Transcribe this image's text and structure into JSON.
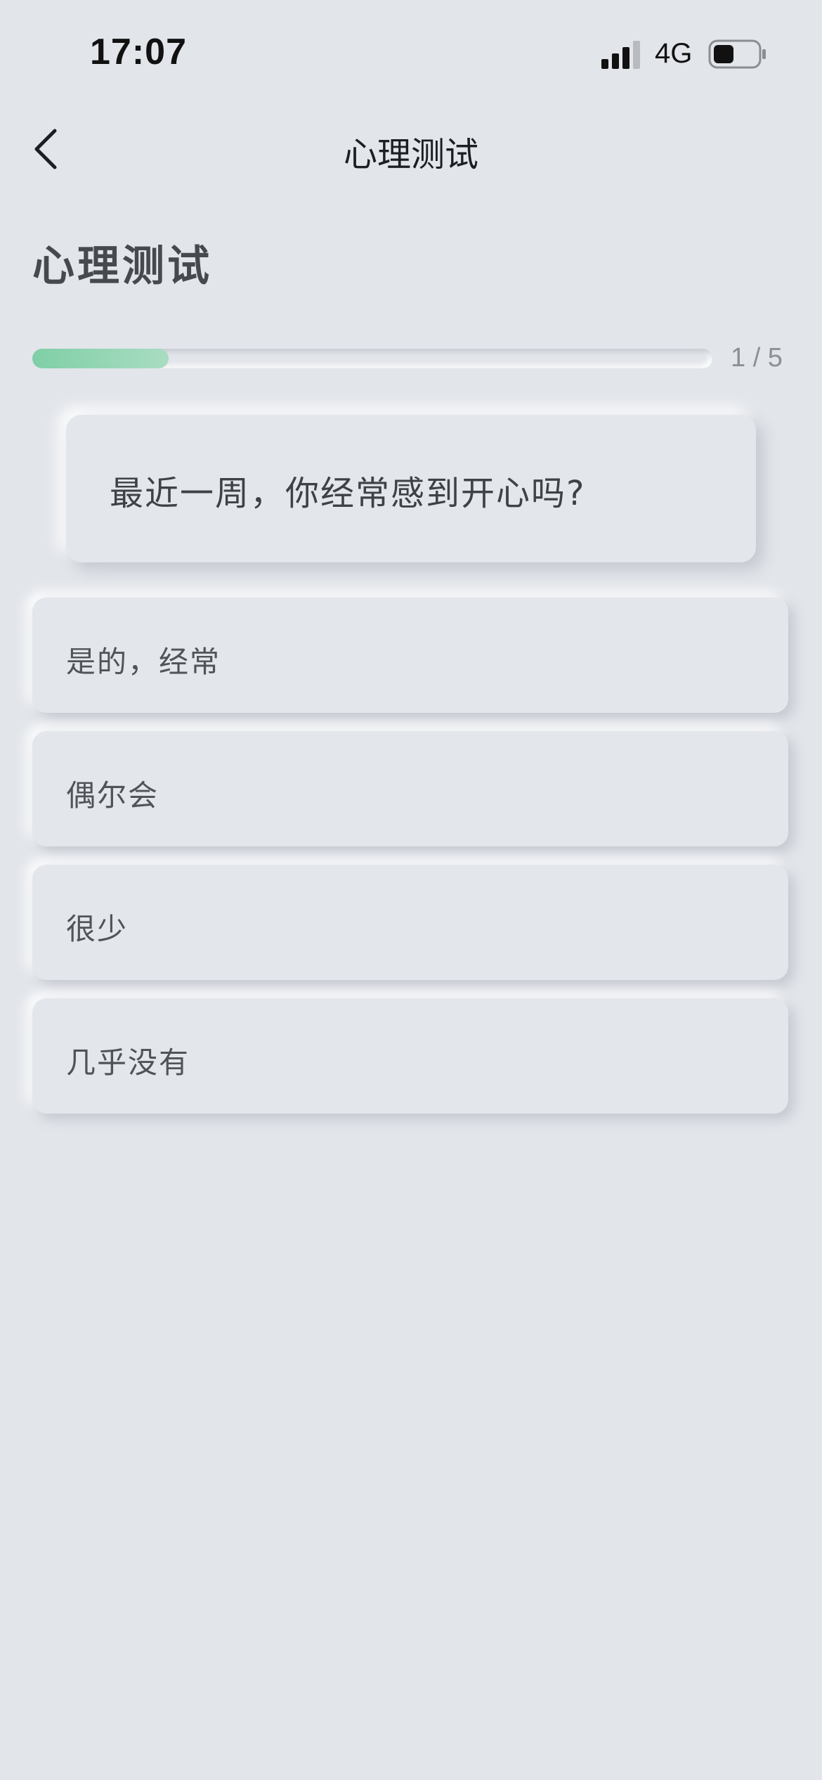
{
  "status_bar": {
    "time": "17:07",
    "network": "4G",
    "icons": [
      "signal-icon",
      "battery-icon"
    ]
  },
  "nav": {
    "title": "心理测试",
    "back_icon": "chevron-left-icon"
  },
  "page": {
    "title": "心理测试"
  },
  "progress": {
    "current": 1,
    "total": 5,
    "label": "1 / 5",
    "fill_fraction": 0.2,
    "fill_color": "#7fcfa6"
  },
  "question": {
    "text": "最近一周，你经常感到开心吗?"
  },
  "options": [
    {
      "label": "是的，经常"
    },
    {
      "label": "偶尔会"
    },
    {
      "label": "很少"
    },
    {
      "label": "几乎没有"
    }
  ],
  "colors": {
    "background": "#e2e5ea",
    "text": "#4a4d52",
    "accent": "#7fcfa6"
  }
}
